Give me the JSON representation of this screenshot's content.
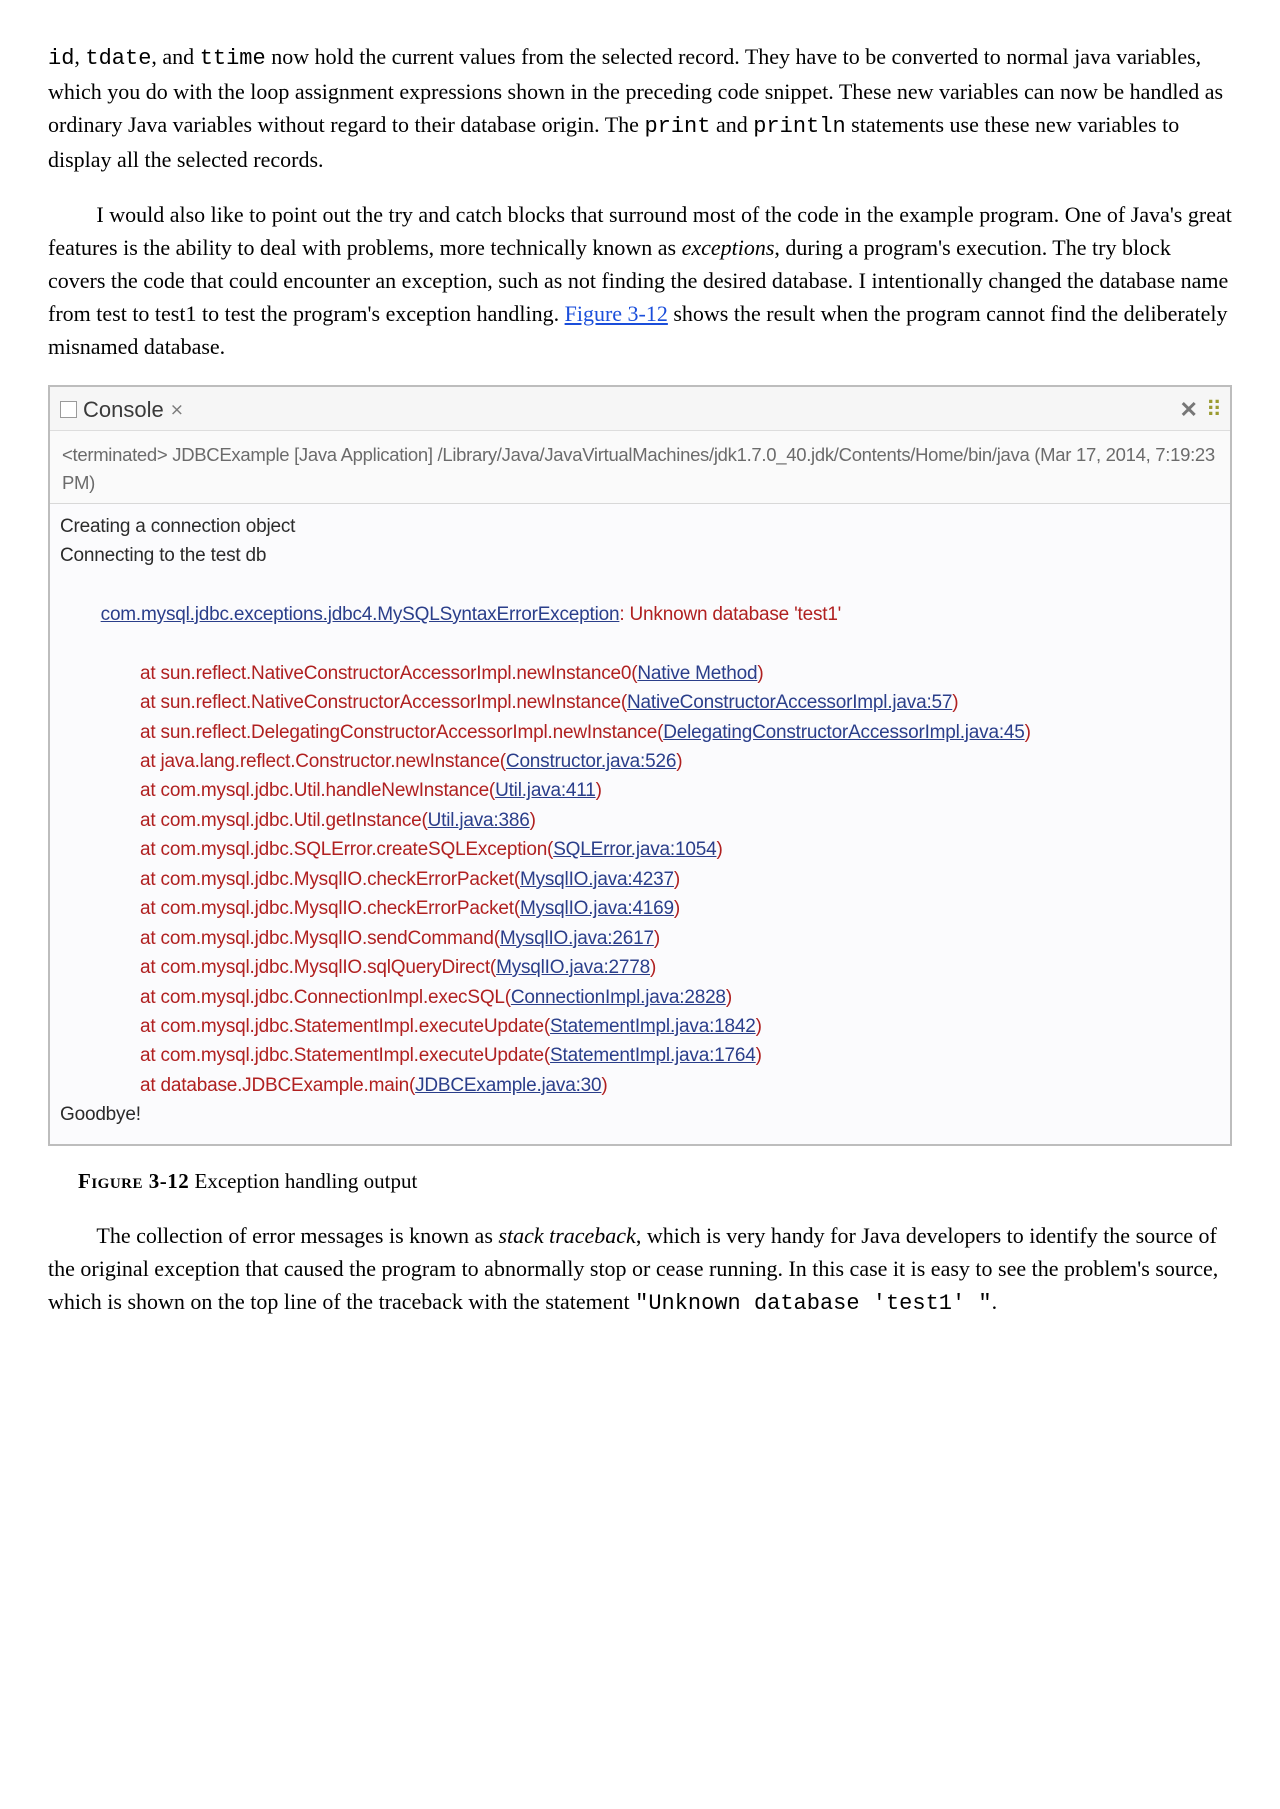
{
  "para1": {
    "seg1": "id",
    "seg2": ", ",
    "seg3": "tdate",
    "seg4": ", and ",
    "seg5": "ttime",
    "seg6": " now hold the current values from the selected record. They have to be converted to normal java variables, which you do with the loop assignment expressions shown in the preceding code snippet. These new variables can now be handled as ordinary Java variables without regard to their database origin. The ",
    "seg7": "print",
    "seg8": " and ",
    "seg9": "println",
    "seg10": " statements use these new variables to display all the selected records."
  },
  "para2": {
    "seg1": "I would also like to point out the try and catch blocks that surround most of the code in the example program. One of Java's great features is the ability to deal with problems, more technically known as ",
    "seg2": "exceptions",
    "seg3": ", during a program's execution. The try block covers the code that could encounter an exception, such as not finding the desired database. I intentionally changed the database name from test to test1 to test the program's exception handling. ",
    "seg4": "Figure 3-12",
    "seg5": " shows the result when the program cannot find the deliberately misnamed database."
  },
  "console": {
    "tab_label": "Console",
    "tab_decor": "⨯",
    "terminated": "<terminated> JDBCExample [Java Application] /Library/Java/JavaVirtualMachines/jdk1.7.0_40.jdk/Contents/Home/bin/java (Mar 17, 2014, 7:19:23 PM)",
    "l1": "Creating a connection object",
    "l2": "Connecting to the test db",
    "ex_head_a": "com.mysql.jdbc.exceptions.jdbc4.MySQLSyntaxErrorException",
    "ex_head_b": ": Unknown database 'test1'",
    "t": [
      {
        "a": "at sun.reflect.NativeConstructorAccessorImpl.newInstance0(",
        "b": "Native Method",
        "c": ")"
      },
      {
        "a": "at sun.reflect.NativeConstructorAccessorImpl.newInstance(",
        "b": "NativeConstructorAccessorImpl.java:57",
        "c": ")"
      },
      {
        "a": "at sun.reflect.DelegatingConstructorAccessorImpl.newInstance(",
        "b": "DelegatingConstructorAccessorImpl.java:45",
        "c": ")"
      },
      {
        "a": "at java.lang.reflect.Constructor.newInstance(",
        "b": "Constructor.java:526",
        "c": ")"
      },
      {
        "a": "at com.mysql.jdbc.Util.handleNewInstance(",
        "b": "Util.java:411",
        "c": ")"
      },
      {
        "a": "at com.mysql.jdbc.Util.getInstance(",
        "b": "Util.java:386",
        "c": ")"
      },
      {
        "a": "at com.mysql.jdbc.SQLError.createSQLException(",
        "b": "SQLError.java:1054",
        "c": ")"
      },
      {
        "a": "at com.mysql.jdbc.MysqlIO.checkErrorPacket(",
        "b": "MysqlIO.java:4237",
        "c": ")"
      },
      {
        "a": "at com.mysql.jdbc.MysqlIO.checkErrorPacket(",
        "b": "MysqlIO.java:4169",
        "c": ")"
      },
      {
        "a": "at com.mysql.jdbc.MysqlIO.sendCommand(",
        "b": "MysqlIO.java:2617",
        "c": ")"
      },
      {
        "a": "at com.mysql.jdbc.MysqlIO.sqlQueryDirect(",
        "b": "MysqlIO.java:2778",
        "c": ")"
      },
      {
        "a": "at com.mysql.jdbc.ConnectionImpl.execSQL(",
        "b": "ConnectionImpl.java:2828",
        "c": ")"
      },
      {
        "a": "at com.mysql.jdbc.StatementImpl.executeUpdate(",
        "b": "StatementImpl.java:1842",
        "c": ")"
      },
      {
        "a": "at com.mysql.jdbc.StatementImpl.executeUpdate(",
        "b": "StatementImpl.java:1764",
        "c": ")"
      },
      {
        "a": "at database.JDBCExample.main(",
        "b": "JDBCExample.java:30",
        "c": ")"
      }
    ],
    "goodbye": "Goodbye!"
  },
  "figcap": {
    "label": "Figure 3-12",
    "text": " Exception handling output"
  },
  "para3": {
    "seg1": "The collection of error messages is known as ",
    "seg2": "stack traceback",
    "seg3": ", which is very handy for Java developers to identify the source of the original exception that caused the program to abnormally stop or cease running. In this case it is easy to see the problem's source, which is shown on the top line of the traceback with the statement ",
    "seg4": "\"Unknown database 'test1' \"",
    "seg5": "."
  }
}
